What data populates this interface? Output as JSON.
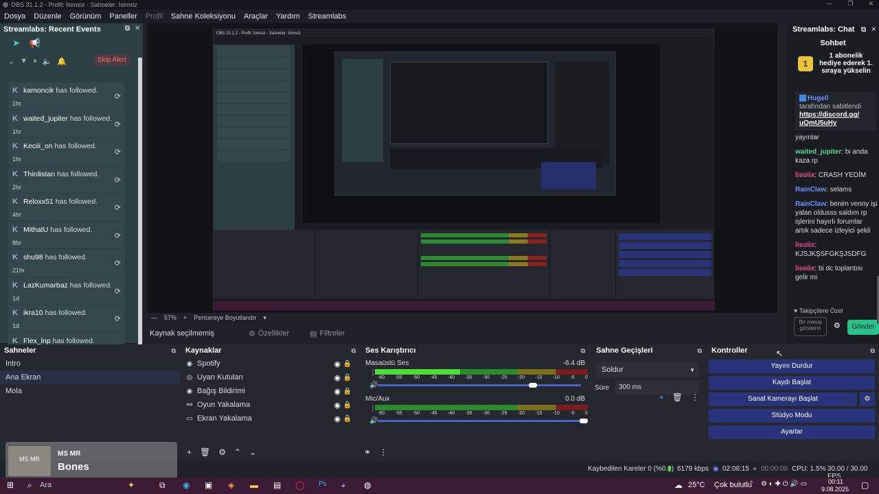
{
  "title": "OBS 31.1.2 - Profil: İsimsiz - Sahneler: İsimsiz",
  "menu": [
    "Dosya",
    "Düzenle",
    "Görünüm",
    "Paneller",
    "Profil",
    "Sahne Koleksiyonu",
    "Araçlar",
    "Yardım",
    "Streamlabs"
  ],
  "events": {
    "header": "Streamlabs: Recent Events",
    "skip": "Skip Alert",
    "items": [
      {
        "user": "kamoncik",
        "text": "has followed.",
        "time": "1hr"
      },
      {
        "user": "waited_jupiter",
        "text": "has followed.",
        "time": "1hr"
      },
      {
        "user": "Keciii_on",
        "text": "has followed.",
        "time": "1hr"
      },
      {
        "user": "Thirdistan",
        "text": "has followed.",
        "time": "2hr"
      },
      {
        "user": "Reloxx51",
        "text": "has followed.",
        "time": "4hr"
      },
      {
        "user": "MithatU",
        "text": "has followed.",
        "time": "8hr"
      },
      {
        "user": "shu98",
        "text": "has followed.",
        "time": "21hr"
      },
      {
        "user": "LazKumarbaz",
        "text": "has followed.",
        "time": "1d"
      },
      {
        "user": "ikra10",
        "text": "has followed.",
        "time": "1d"
      },
      {
        "user": "Flex_lnp",
        "text": "has followed.",
        "time": ""
      }
    ]
  },
  "preview": {
    "zoom": "57%",
    "fit": "Pencereye Boyutlandır",
    "no_source": "Kaynak seçilmemiş",
    "properties": "Özellikler",
    "filters": "Filtreler"
  },
  "chat": {
    "header": "Streamlabs: Chat",
    "title": "Sohbet",
    "pinned": "1 abonelik hediye ederek 1. sıraya yükselin",
    "pin_user": "Huge0",
    "pin_text": "tarafından sabitlendi",
    "pin_link": "https://discord.gg/ uQmU5uHy",
    "pin_tail": "yayınlar",
    "messages": [
      {
        "user": "waited_jupiter",
        "text": ": bi anda kaza rp",
        "cls": "u1"
      },
      {
        "user": "lisolix",
        "text": ": CRASH YEDİM",
        "cls": "u4"
      },
      {
        "user": "RainClaw",
        "text": ": selams",
        "cls": "u3"
      },
      {
        "user": "RainClaw",
        "text": ": benim venny işi yalan oldusss saldım rp işlerini hayırlı forumlar artık sadece izleyici şekli",
        "cls": "u3"
      },
      {
        "user": "lisolix",
        "text": ": KJSJKŞSFGKŞJSDFG",
        "cls": "u4"
      },
      {
        "user": "lisolix",
        "text": ": bi dc toplantısı gelir mi",
        "cls": "u4"
      }
    ],
    "follow_only": "Takipçilere Özel",
    "placeholder": "Bir mesaj gönderin",
    "send": "Gönder"
  },
  "scenes": {
    "header": "Sahneler",
    "items": [
      "Intro",
      "Ana Ekran",
      "Mola"
    ],
    "selected": 1
  },
  "sources": {
    "header": "Kaynaklar",
    "items": [
      "Spotify",
      "Uyarı Kutuları",
      "Bağış Bildirimi",
      "Oyun Yakalama",
      "Ekran Yakalama"
    ]
  },
  "mixer": {
    "header": "Ses Karıştırıcı",
    "channels": [
      {
        "name": "Masaüstü Ses",
        "db": "-6.4 dB"
      },
      {
        "name": "Mic/Aux",
        "db": "0.0 dB"
      }
    ],
    "ticks": [
      "-60",
      "-55",
      "-50",
      "-45",
      "-40",
      "-35",
      "-30",
      "-25",
      "-20",
      "-15",
      "-10",
      "-5",
      "0"
    ]
  },
  "transitions": {
    "header": "Sahne Geçişleri",
    "selected": "Soldur",
    "duration_label": "Süre",
    "duration": "300 ms"
  },
  "controls": {
    "header": "Kontroller",
    "buttons": [
      "Yayını Durdur",
      "Kaydı Başlat",
      "Sanal Kamerayı Başlat",
      "Stüdyo Modu",
      "Ayarlar"
    ]
  },
  "status": {
    "dropped": "Kaybedilen Kareler 0 (%0.0)",
    "bitrate": "6179 kbps",
    "stream_time": "02:06:15",
    "rec_time": "00:00:00",
    "cpu": "CPU: 1.5%",
    "fps": "30.00 / 30.00 FPS"
  },
  "overlay": {
    "badge": "MS MR",
    "name": "Bones",
    "logo": "MS MR"
  },
  "taskbar": {
    "search": "Ara",
    "weather_temp": "25°C",
    "weather_text": "Çok bulutlu",
    "time": "00:11",
    "date": "9.08.2025"
  },
  "nested": {
    "title": "OBS 31.1.2 - Profil: İsimsiz - Sahneler: İsimsiz"
  }
}
